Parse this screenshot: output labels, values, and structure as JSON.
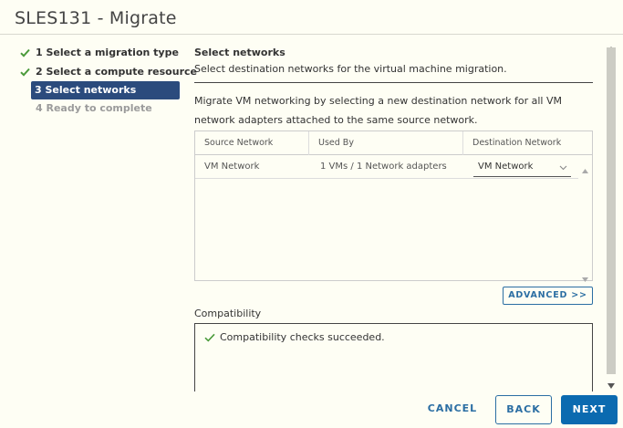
{
  "window": {
    "title": "SLES131 - Migrate"
  },
  "steps": [
    {
      "label": "1 Select a migration type",
      "state": "done"
    },
    {
      "label": "2 Select a compute resource",
      "state": "done"
    },
    {
      "label": "3 Select networks",
      "state": "active"
    },
    {
      "label": "4 Ready to complete",
      "state": "disabled"
    }
  ],
  "section": {
    "title": "Select networks",
    "subtitle": "Select destination networks for the virtual machine migration.",
    "description": "Migrate VM networking by selecting a new destination network for all VM network adapters attached to the same source network."
  },
  "table": {
    "columns": [
      "Source Network",
      "Used By",
      "Destination Network"
    ],
    "rows": [
      {
        "source": "VM Network",
        "used_by": "1 VMs / 1 Network adapters",
        "destination": "VM Network"
      }
    ]
  },
  "advanced_button": {
    "label": "ADVANCED >>"
  },
  "compatibility": {
    "label": "Compatibility",
    "message": "Compatibility checks succeeded."
  },
  "footer": {
    "cancel_label": "CANCEL",
    "back_label": "BACK",
    "next_label": "NEXT"
  },
  "colors": {
    "accent": "#2b6ea3",
    "active_step": "#2b4b7d",
    "primary_button": "#0b6ab0",
    "success": "#4a9a3a",
    "background": "#fefef4"
  },
  "icons": {
    "step_done": "check-icon",
    "dropdown": "chevron-down-icon",
    "compat_ok": "check-icon"
  }
}
